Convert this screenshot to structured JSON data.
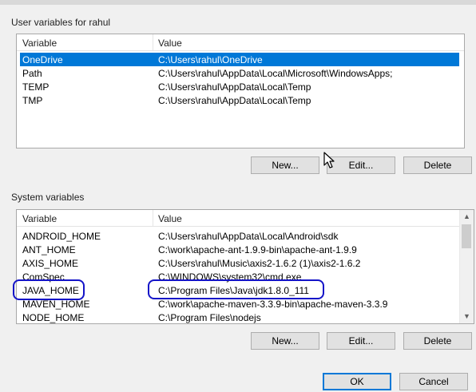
{
  "user_section": {
    "title": "User variables for rahul",
    "columns": {
      "variable": "Variable",
      "value": "Value"
    },
    "rows": [
      {
        "variable": "OneDrive",
        "value": "C:\\Users\\rahul\\OneDrive",
        "selected": true
      },
      {
        "variable": "Path",
        "value": "C:\\Users\\rahul\\AppData\\Local\\Microsoft\\WindowsApps;"
      },
      {
        "variable": "TEMP",
        "value": "C:\\Users\\rahul\\AppData\\Local\\Temp"
      },
      {
        "variable": "TMP",
        "value": "C:\\Users\\rahul\\AppData\\Local\\Temp"
      }
    ],
    "buttons": {
      "new": "New...",
      "edit": "Edit...",
      "delete": "Delete"
    }
  },
  "system_section": {
    "title": "System variables",
    "columns": {
      "variable": "Variable",
      "value": "Value"
    },
    "rows": [
      {
        "variable": "ANDROID_HOME",
        "value": "C:\\Users\\rahul\\AppData\\Local\\Android\\sdk"
      },
      {
        "variable": "ANT_HOME",
        "value": "C:\\work\\apache-ant-1.9.9-bin\\apache-ant-1.9.9"
      },
      {
        "variable": "AXIS_HOME",
        "value": "C:\\Users\\rahul\\Music\\axis2-1.6.2 (1)\\axis2-1.6.2"
      },
      {
        "variable": "ComSpec",
        "value": "C:\\WINDOWS\\system32\\cmd.exe"
      },
      {
        "variable": "JAVA_HOME",
        "value": "C:\\Program Files\\Java\\jdk1.8.0_111"
      },
      {
        "variable": "MAVEN_HOME",
        "value": "C:\\work\\apache-maven-3.3.9-bin\\apache-maven-3.3.9"
      },
      {
        "variable": "NODE_HOME",
        "value": "C:\\Program Files\\nodejs"
      }
    ],
    "buttons": {
      "new": "New...",
      "edit": "Edit...",
      "delete": "Delete"
    }
  },
  "dialog_buttons": {
    "ok": "OK",
    "cancel": "Cancel"
  },
  "colors": {
    "selection": "#0078d7",
    "annotation": "#1414c8"
  },
  "icons": {
    "scroll_up": "chevron-up-icon",
    "scroll_down": "chevron-down-icon",
    "cursor": "mouse-pointer-icon"
  }
}
